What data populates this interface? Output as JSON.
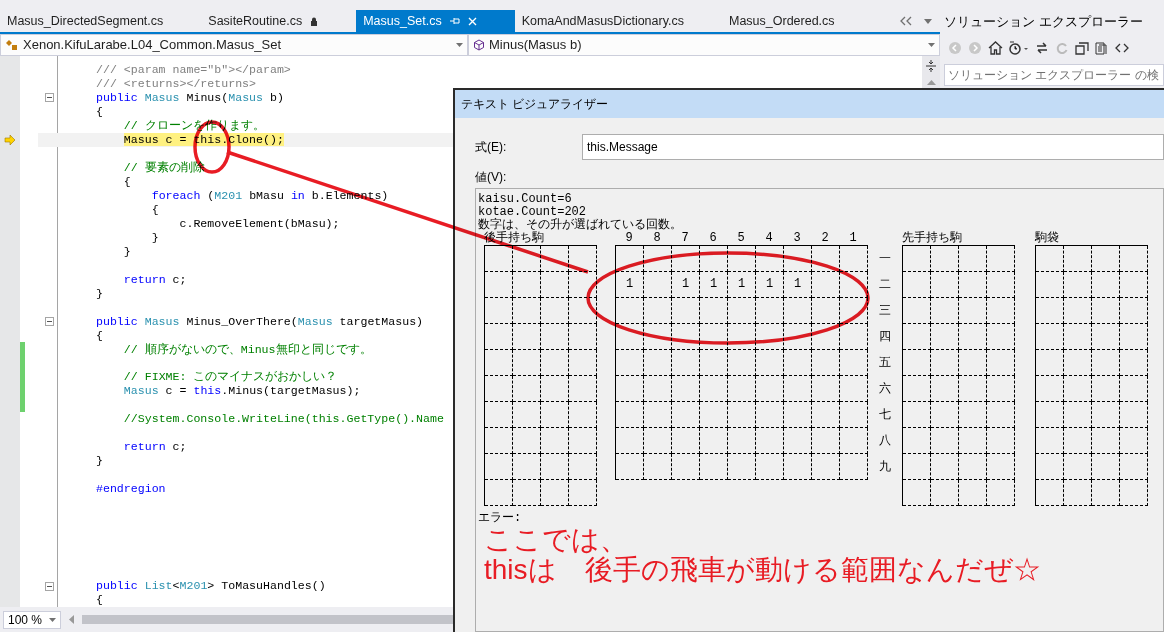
{
  "tabs": [
    {
      "label": "Masus_DirectedSegment.cs",
      "selected": false,
      "locked": false
    },
    {
      "label": "SasiteRoutine.cs",
      "selected": false,
      "locked": true
    },
    {
      "label": "Masus_Set.cs",
      "selected": true,
      "locked": false
    },
    {
      "label": "KomaAndMasusDictionary.cs",
      "selected": false,
      "locked": false
    },
    {
      "label": "Masus_Ordered.cs",
      "selected": false,
      "locked": false
    }
  ],
  "navigation": {
    "type_dropdown": "Xenon.KifuLarabe.L04_Common.Masus_Set",
    "member_dropdown": "Minus(Masus b)"
  },
  "editor": {
    "zoom": "100 %",
    "lines": [
      {
        "fold": false,
        "current": false,
        "changed": false,
        "tokens": [
          {
            "kind": "doc",
            "text": "/// <param name=\"b\"></param>"
          }
        ]
      },
      {
        "fold": false,
        "current": false,
        "changed": false,
        "tokens": [
          {
            "kind": "doc",
            "text": "/// <returns></returns>"
          }
        ]
      },
      {
        "fold": true,
        "current": false,
        "changed": false,
        "tokens": [
          {
            "kind": "kw",
            "text": "public "
          },
          {
            "kind": "type",
            "text": "Masus"
          },
          {
            "kind": "plain",
            "text": " Minus("
          },
          {
            "kind": "type",
            "text": "Masus"
          },
          {
            "kind": "plain",
            "text": " b)"
          }
        ]
      },
      {
        "fold": false,
        "current": false,
        "changed": false,
        "tokens": [
          {
            "kind": "plain",
            "text": "{"
          }
        ]
      },
      {
        "fold": false,
        "current": false,
        "changed": false,
        "tokens": [
          {
            "kind": "comment",
            "text": "    // クローンを作ります。"
          }
        ]
      },
      {
        "fold": false,
        "current": true,
        "changed": false,
        "tokens": [
          {
            "kind": "plain",
            "text": "    Masus c = this.Clone();"
          }
        ]
      },
      {
        "fold": false,
        "current": false,
        "changed": false
      },
      {
        "fold": false,
        "current": false,
        "changed": false,
        "tokens": [
          {
            "kind": "comment",
            "text": "    // 要素の削除"
          }
        ]
      },
      {
        "fold": false,
        "current": false,
        "changed": false,
        "tokens": [
          {
            "kind": "plain",
            "text": "    {"
          }
        ]
      },
      {
        "fold": false,
        "current": false,
        "changed": false,
        "tokens": [
          {
            "kind": "kw",
            "text": "        foreach"
          },
          {
            "kind": "plain",
            "text": " ("
          },
          {
            "kind": "type",
            "text": "M201"
          },
          {
            "kind": "plain",
            "text": " bMasu "
          },
          {
            "kind": "kw",
            "text": "in"
          },
          {
            "kind": "plain",
            "text": " b.Elements)"
          }
        ]
      },
      {
        "fold": false,
        "current": false,
        "changed": false,
        "tokens": [
          {
            "kind": "plain",
            "text": "        {"
          }
        ]
      },
      {
        "fold": false,
        "current": false,
        "changed": false,
        "tokens": [
          {
            "kind": "plain",
            "text": "            c.RemoveElement(bMasu);"
          }
        ]
      },
      {
        "fold": false,
        "current": false,
        "changed": false,
        "tokens": [
          {
            "kind": "plain",
            "text": "        }"
          }
        ]
      },
      {
        "fold": false,
        "current": false,
        "changed": false,
        "tokens": [
          {
            "kind": "plain",
            "text": "    }"
          }
        ]
      },
      {
        "fold": false,
        "current": false,
        "changed": false
      },
      {
        "fold": false,
        "current": false,
        "changed": false,
        "tokens": [
          {
            "kind": "kw",
            "text": "    return"
          },
          {
            "kind": "plain",
            "text": " c;"
          }
        ]
      },
      {
        "fold": false,
        "current": false,
        "changed": false,
        "tokens": [
          {
            "kind": "plain",
            "text": "}"
          }
        ]
      },
      {
        "fold": false,
        "current": false,
        "changed": false
      },
      {
        "fold": true,
        "current": false,
        "changed": false,
        "tokens": [
          {
            "kind": "kw",
            "text": "public "
          },
          {
            "kind": "type",
            "text": "Masus"
          },
          {
            "kind": "plain",
            "text": " Minus_OverThere("
          },
          {
            "kind": "type",
            "text": "Masus"
          },
          {
            "kind": "plain",
            "text": " targetMasus)"
          }
        ]
      },
      {
        "fold": false,
        "current": false,
        "changed": false,
        "tokens": [
          {
            "kind": "plain",
            "text": "{"
          }
        ]
      },
      {
        "fold": false,
        "current": false,
        "changed": true,
        "tokens": [
          {
            "kind": "comment",
            "text": "    // 順序がないので、Minus無印と同じです。"
          }
        ]
      },
      {
        "fold": false,
        "current": false,
        "changed": true
      },
      {
        "fold": false,
        "current": false,
        "changed": true,
        "tokens": [
          {
            "kind": "comment",
            "text": "    // FIXME: このマイナスがおかしい？"
          }
        ]
      },
      {
        "fold": false,
        "current": false,
        "changed": true,
        "tokens": [
          {
            "kind": "type",
            "text": "    Masus"
          },
          {
            "kind": "plain",
            "text": " c = "
          },
          {
            "kind": "kw",
            "text": "this"
          },
          {
            "kind": "plain",
            "text": ".Minus(targetMasus);"
          }
        ]
      },
      {
        "fold": false,
        "current": false,
        "changed": true
      },
      {
        "fold": false,
        "current": false,
        "changed": false,
        "tokens": [
          {
            "kind": "comment",
            "text": "    //System.Console.WriteLine(this.GetType().Name"
          }
        ]
      },
      {
        "fold": false,
        "current": false,
        "changed": false
      },
      {
        "fold": false,
        "current": false,
        "changed": false,
        "tokens": [
          {
            "kind": "kw",
            "text": "    return"
          },
          {
            "kind": "plain",
            "text": " c;"
          }
        ]
      },
      {
        "fold": false,
        "current": false,
        "changed": false,
        "tokens": [
          {
            "kind": "plain",
            "text": "}"
          }
        ]
      },
      {
        "fold": false,
        "current": false,
        "changed": false
      },
      {
        "fold": false,
        "current": false,
        "changed": false,
        "tokens": [
          {
            "kind": "kw",
            "text": "#endregion"
          }
        ]
      },
      {
        "fold": false,
        "current": false,
        "changed": false
      },
      {
        "fold": false,
        "current": false,
        "changed": false
      },
      {
        "fold": false,
        "current": false,
        "changed": false
      },
      {
        "fold": false,
        "current": false,
        "changed": false
      },
      {
        "fold": false,
        "current": false,
        "changed": false
      },
      {
        "fold": false,
        "current": false,
        "changed": false
      },
      {
        "fold": true,
        "current": false,
        "changed": false,
        "tokens": [
          {
            "kind": "kw",
            "text": "public "
          },
          {
            "kind": "type",
            "text": "List"
          },
          {
            "kind": "plain",
            "text": "<"
          },
          {
            "kind": "type",
            "text": "M201"
          },
          {
            "kind": "plain",
            "text": "> ToMasuHandles()"
          }
        ]
      },
      {
        "fold": false,
        "current": false,
        "changed": false,
        "tokens": [
          {
            "kind": "plain",
            "text": "{"
          }
        ]
      }
    ]
  },
  "solution_explorer": {
    "title": "ソリューション エクスプローラー",
    "search": {
      "placeholder": "ソリューション エクスプローラー の検"
    }
  },
  "visualizer": {
    "title": "テキスト ビジュアライザー",
    "expression_label": "式(E):",
    "expression": "this.Message",
    "value_label": "値(V):",
    "value_lines": [
      "kaisu.Count=6",
      "kotae.Count=202",
      "数字は、その升が選ばれている回数。"
    ],
    "gote_hand_label": "後手持ち駒",
    "sente_hand_label": "先手持ち駒",
    "bag_label": "駒袋",
    "files": [
      "9",
      "8",
      "7",
      "6",
      "5",
      "4",
      "3",
      "2",
      "1"
    ],
    "ranks": [
      {
        "label": "一",
        "cells": [
          null,
          null,
          null,
          null,
          null,
          null,
          null,
          null,
          null
        ]
      },
      {
        "label": "二",
        "cells": [
          "1",
          null,
          "1",
          "1",
          "1",
          "1",
          "1",
          null,
          null
        ]
      },
      {
        "label": "三",
        "cells": [
          null,
          null,
          null,
          null,
          null,
          null,
          null,
          null,
          null
        ]
      },
      {
        "label": "四",
        "cells": [
          null,
          null,
          null,
          null,
          null,
          null,
          null,
          null,
          null
        ]
      },
      {
        "label": "五",
        "cells": [
          null,
          null,
          null,
          null,
          null,
          null,
          null,
          null,
          null
        ]
      },
      {
        "label": "六",
        "cells": [
          null,
          null,
          null,
          null,
          null,
          null,
          null,
          null,
          null
        ]
      },
      {
        "label": "七",
        "cells": [
          null,
          null,
          null,
          null,
          null,
          null,
          null,
          null,
          null
        ]
      },
      {
        "label": "八",
        "cells": [
          null,
          null,
          null,
          null,
          null,
          null,
          null,
          null,
          null
        ]
      },
      {
        "label": "九",
        "cells": [
          null,
          null,
          null,
          null,
          null,
          null,
          null,
          null,
          null
        ]
      }
    ],
    "error_label": "エラー:",
    "annotation": [
      "ここでは、",
      "thisは　後手の飛車が動ける範囲なんだぜ☆"
    ]
  }
}
